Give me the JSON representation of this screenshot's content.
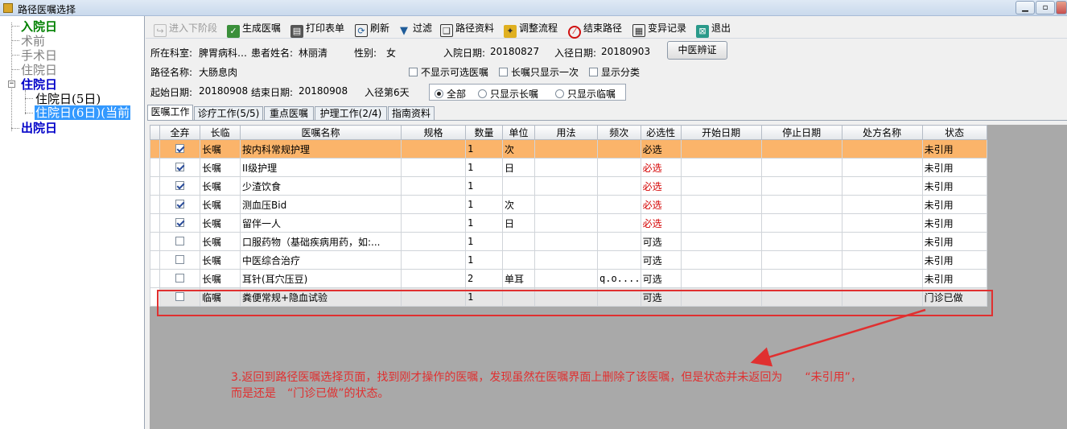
{
  "window": {
    "title": "路径医嘱选择"
  },
  "tree": {
    "items": [
      {
        "label": "入院日",
        "color": "#008000"
      },
      {
        "label": "术前",
        "color": "#808080"
      },
      {
        "label": "手术日",
        "color": "#808080"
      },
      {
        "label": "住院日",
        "color": "#808080"
      },
      {
        "label": "住院日",
        "color": "#0000c8"
      },
      {
        "label": "住院日(5日)",
        "color": "#000000"
      },
      {
        "label": "住院日(6日)(当前",
        "color": "#ffffff"
      },
      {
        "label": "出院日",
        "color": "#0000c8"
      }
    ],
    "expander": "−"
  },
  "toolbar": {
    "next_stage": "进入下阶段",
    "generate_orders": "生成医嘱",
    "print_form": "打印表单",
    "refresh": "刷新",
    "filter": "过滤",
    "path_data": "路径资料",
    "adjust_flow": "调整流程",
    "end_path": "结束路径",
    "change_log": "变异记录",
    "exit": "退出"
  },
  "patient": {
    "dept_label": "所在科室:",
    "dept_value": "脾胃病科…",
    "name_label": "患者姓名:",
    "name_value": "林丽清",
    "sex_label": "性别:",
    "sex_value": "女",
    "admit_label": "入院日期:",
    "admit_value": "20180827",
    "path_in_label": "入径日期:",
    "path_in_value": "20180903",
    "path_name_label": "路径名称:",
    "path_name_value": "大肠息肉",
    "start_label": "起始日期:",
    "start_value": "20180908",
    "end_label": "结束日期:",
    "end_value": "20180908",
    "day_label": "入径第6天",
    "tcm_button": "中医辨证"
  },
  "options": {
    "hide_optional": "不显示可选医嘱",
    "long_once": "长嘱只显示一次",
    "show_category": "显示分类",
    "radio_all": "全部",
    "radio_long": "只显示长嘱",
    "radio_temp": "只显示临嘱"
  },
  "tabs": [
    {
      "label": "医嘱工作"
    },
    {
      "label": "诊疗工作(5/5)"
    },
    {
      "label": "重点医嘱"
    },
    {
      "label": "护理工作(2/4)"
    },
    {
      "label": "指南资料"
    }
  ],
  "grid": {
    "columns": [
      "全弃",
      "长临",
      "医嘱名称",
      "规格",
      "数量",
      "单位",
      "用法",
      "频次",
      "必选性",
      "开始日期",
      "停止日期",
      "处方名称",
      "状态"
    ],
    "rows": [
      {
        "checked": true,
        "type": "长嘱",
        "name": "按内科常规护理",
        "spec": "",
        "qty": "1",
        "unit": "次",
        "usage": "",
        "freq": "",
        "required": "必选",
        "req_red": false,
        "start": "",
        "stop": "",
        "rx": "",
        "status": "未引用"
      },
      {
        "checked": true,
        "type": "长嘱",
        "name": "II级护理",
        "spec": "",
        "qty": "1",
        "unit": "日",
        "usage": "",
        "freq": "",
        "required": "必选",
        "req_red": true,
        "start": "",
        "stop": "",
        "rx": "",
        "status": "未引用"
      },
      {
        "checked": true,
        "type": "长嘱",
        "name": "少渣饮食",
        "spec": "",
        "qty": "1",
        "unit": "",
        "usage": "",
        "freq": "",
        "required": "必选",
        "req_red": true,
        "start": "",
        "stop": "",
        "rx": "",
        "status": "未引用"
      },
      {
        "checked": true,
        "type": "长嘱",
        "name": "测血压Bid",
        "spec": "",
        "qty": "1",
        "unit": "次",
        "usage": "",
        "freq": "",
        "required": "必选",
        "req_red": true,
        "start": "",
        "stop": "",
        "rx": "",
        "status": "未引用"
      },
      {
        "checked": true,
        "type": "长嘱",
        "name": "留伴一人",
        "spec": "",
        "qty": "1",
        "unit": "日",
        "usage": "",
        "freq": "",
        "required": "必选",
        "req_red": true,
        "start": "",
        "stop": "",
        "rx": "",
        "status": "未引用"
      },
      {
        "checked": false,
        "type": "长嘱",
        "name": "口服药物（基础疾病用药，如:...",
        "spec": "",
        "qty": "1",
        "unit": "",
        "usage": "",
        "freq": "",
        "required": "可选",
        "req_red": false,
        "start": "",
        "stop": "",
        "rx": "",
        "status": "未引用"
      },
      {
        "checked": false,
        "type": "长嘱",
        "name": "中医综合治疗",
        "spec": "",
        "qty": "1",
        "unit": "",
        "usage": "",
        "freq": "",
        "required": "可选",
        "req_red": false,
        "start": "",
        "stop": "",
        "rx": "",
        "status": "未引用"
      },
      {
        "checked": false,
        "type": "长嘱",
        "name": "耳针(耳穴压豆)",
        "spec": "",
        "qty": "2",
        "unit": "单耳",
        "usage": "",
        "freq": "q.o....",
        "required": "可选",
        "req_red": false,
        "start": "",
        "stop": "",
        "rx": "",
        "status": "未引用"
      },
      {
        "checked": false,
        "type": "临嘱",
        "name": "粪便常规+隐血试验",
        "spec": "",
        "qty": "1",
        "unit": "",
        "usage": "",
        "freq": "",
        "required": "可选",
        "req_red": false,
        "start": "",
        "stop": "",
        "rx": "",
        "status": "门诊已做"
      }
    ]
  },
  "annotation": {
    "line1": "3.返回到路径医嘱选择页面，找到刚才操作的医嘱，发现虽然在医嘱界面上删除了该医嘱，但是状态并未返回为　　“未引用”，",
    "line2": "而是还是　“门诊已做”的状态。",
    "color": "#e03030"
  }
}
